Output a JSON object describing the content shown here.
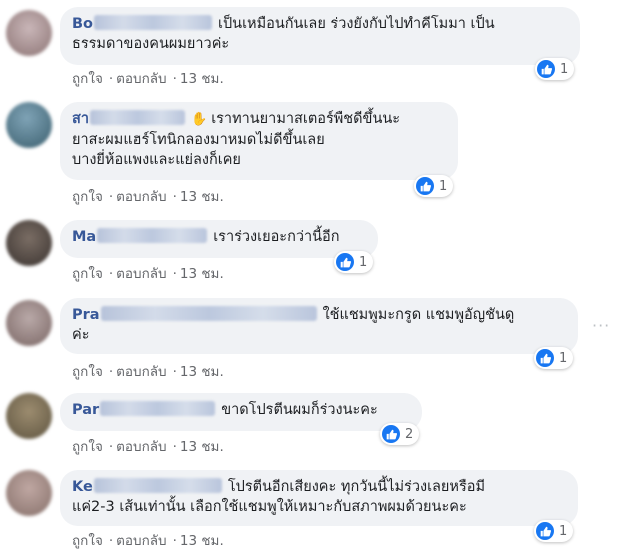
{
  "comments": [
    {
      "name": "Bo",
      "line1": "เป็นเหมือนกันเลย ร่วงยังกับไปทำคีโมมา เป็น",
      "line2": "ธรรมดาของคนผมยาวค่ะ",
      "like": "ถูกใจ",
      "reply": "ตอบกลับ",
      "time": "13 ชม.",
      "reactions": "1"
    },
    {
      "name": "สา",
      "line1": "เราทานยามาสเตอร์พืชดีขึ้นนะ",
      "line2": "ยาสะผมแฮร์โทนิกลองมาหมดไม่ดีขึ้นเลย",
      "line3": "บางยี่ห้อแพงและแย่ลงก็เคย",
      "like": "ถูกใจ",
      "reply": "ตอบกลับ",
      "time": "13 ชม.",
      "reactions": "1"
    },
    {
      "name": "Ma",
      "line1": "เราร่วงเยอะกว่านี้อีก",
      "like": "ถูกใจ",
      "reply": "ตอบกลับ",
      "time": "13 ชม.",
      "reactions": "1"
    },
    {
      "name": "Pra",
      "line1": "ใช้แชมพูมะกรูด แชมพูอัญชันดู",
      "line2": "ค่ะ",
      "like": "ถูกใจ",
      "reply": "ตอบกลับ",
      "time": "13 ชม.",
      "reactions": "1"
    },
    {
      "name": "Par",
      "line1": "ขาดโปรตีนผมก็ร่วงนะคะ",
      "like": "ถูกใจ",
      "reply": "ตอบกลับ",
      "time": "13 ชม.",
      "reactions": "2"
    },
    {
      "name": "Ke",
      "line1": "โปรตีนอีกเสียงคะ ทุกวันนี้ไม่ร่วงเลยหรือมี",
      "line2": "แค่2-3 เส้นเท่านั้น เลือกใช้แชมพูให้เหมาะกับสภาพผมด้วยนะคะ",
      "like": "ถูกใจ",
      "reply": "ตอบกลับ",
      "time": "13 ชม.",
      "reactions": "1"
    }
  ],
  "separator": "·",
  "more_label": "···",
  "colors": {
    "name": "#385898",
    "bubble": "#f0f2f5",
    "like": "#1877f2",
    "meta": "#65676b"
  }
}
